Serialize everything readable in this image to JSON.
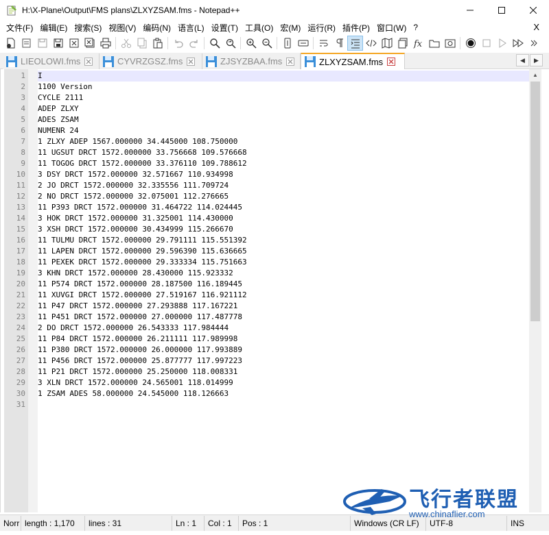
{
  "window": {
    "title": "H:\\X-Plane\\Output\\FMS plans\\ZLXYZSAM.fms - Notepad++"
  },
  "menu": {
    "items": [
      "文件(F)",
      "编辑(E)",
      "搜索(S)",
      "视图(V)",
      "编码(N)",
      "语言(L)",
      "设置(T)",
      "工具(O)",
      "宏(M)",
      "运行(R)",
      "插件(P)",
      "窗口(W)",
      "?"
    ],
    "close_label": "X"
  },
  "tabs": [
    {
      "label": "LIEOLOWI.fms",
      "active": false
    },
    {
      "label": "CYVRZGSZ.fms",
      "active": false
    },
    {
      "label": "ZJSYZBAA.fms",
      "active": false
    },
    {
      "label": "ZLXYZSAM.fms",
      "active": true
    }
  ],
  "editor": {
    "line_numbers": [
      "1",
      "2",
      "3",
      "4",
      "5",
      "6",
      "7",
      "8",
      "9",
      "10",
      "11",
      "12",
      "13",
      "14",
      "15",
      "16",
      "17",
      "18",
      "19",
      "20",
      "21",
      "22",
      "23",
      "24",
      "25",
      "26",
      "27",
      "28",
      "29",
      "30",
      "31"
    ],
    "lines": [
      "I",
      "1100 Version",
      "CYCLE 2111",
      "ADEP ZLXY",
      "ADES ZSAM",
      "NUMENR 24",
      "1 ZLXY ADEP 1567.000000 34.445000 108.750000",
      "11 UGSUT DRCT 1572.000000 33.756668 109.576668",
      "11 TOGOG DRCT 1572.000000 33.376110 109.788612",
      "3 DSY DRCT 1572.000000 32.571667 110.934998",
      "2 JO DRCT 1572.000000 32.335556 111.709724",
      "2 NO DRCT 1572.000000 32.075001 112.276665",
      "11 P393 DRCT 1572.000000 31.464722 114.024445",
      "3 HOK DRCT 1572.000000 31.325001 114.430000",
      "3 XSH DRCT 1572.000000 30.434999 115.266670",
      "11 TULMU DRCT 1572.000000 29.791111 115.551392",
      "11 LAPEN DRCT 1572.000000 29.596390 115.636665",
      "11 PEXEK DRCT 1572.000000 29.333334 115.751663",
      "3 KHN DRCT 1572.000000 28.430000 115.923332",
      "11 P574 DRCT 1572.000000 28.187500 116.189445",
      "11 XUVGI DRCT 1572.000000 27.519167 116.921112",
      "11 P47 DRCT 1572.000000 27.293888 117.167221",
      "11 P451 DRCT 1572.000000 27.000000 117.487778",
      "2 DO DRCT 1572.000000 26.543333 117.984444",
      "11 P84 DRCT 1572.000000 26.211111 117.989998",
      "11 P380 DRCT 1572.000000 26.000000 117.993889",
      "11 P456 DRCT 1572.000000 25.877777 117.997223",
      "11 P21 DRCT 1572.000000 25.250000 118.008331",
      "3 XLN DRCT 1572.000000 24.565001 118.014999",
      "1 ZSAM ADES 58.000000 24.545000 118.126663",
      ""
    ]
  },
  "status": {
    "type": "Norr",
    "length": "length : 1,170",
    "lines": "lines : 31",
    "ln": "Ln : 1",
    "col": "Col : 1",
    "pos": "Pos : 1",
    "eol": "Windows (CR LF)",
    "encoding": "UTF-8",
    "mode": "INS"
  },
  "watermark": {
    "title": "飞行者联盟",
    "url": "www.chinaflier.com"
  },
  "colors": {
    "active_tab_accent": "#f5a623",
    "current_line": "#e8e8ff",
    "watermark": "#1f5fb3"
  }
}
